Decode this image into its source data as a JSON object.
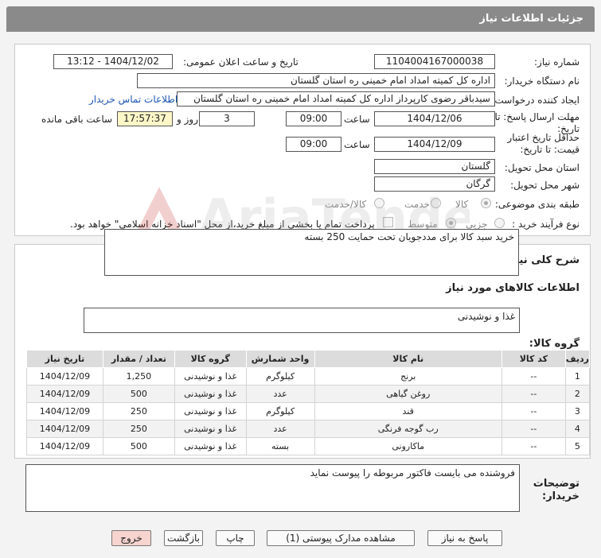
{
  "header": {
    "title": "جزئیات اطلاعات نیاز"
  },
  "form": {
    "need_number_label": "شماره نیاز:",
    "need_number": "1104004167000038",
    "announce_label": "تاریخ و ساعت اعلان عمومی:",
    "announce_value": "1404/12/02 - 13:12",
    "buyer_label": "نام دستگاه خریدار:",
    "buyer_value": "اداره کل کمیته امداد امام خمینی  ره  استان گلستان",
    "creator_label": "ایجاد کننده درخواست:",
    "creator_value": "سیدباقر رضوی کارپرداز اداره کل کمیته امداد امام خمینی  ره  استان گلستان",
    "contact_link": "اطلاعات تماس خریدار",
    "deadline_label_1": "مهلت ارسال پاسخ: تا",
    "deadline_label_2": "تاریخ:",
    "deadline_date": "1404/12/06",
    "time_label": "ساعت",
    "deadline_time": "09:00",
    "days_value": "3",
    "days_label": "روز و",
    "remaining_value": "17:57:37",
    "remaining_label": "ساعت باقی مانده",
    "validity_label_1": "حداقل تاریخ اعتبار",
    "validity_label_2": "قیمت: تا تاریخ:",
    "validity_date": "1404/12/09",
    "validity_time": "09:00",
    "province_label": "استان محل تحویل:",
    "province_value": "گلستان",
    "city_label": "شهر محل تحویل:",
    "city_value": "گرگان",
    "category_label": "طبقه بندی موضوعی:",
    "category_options": [
      "کالا",
      "خدمت",
      "کالا/خدمت"
    ],
    "process_label": "نوع فرآیند خرید :",
    "process_options": [
      "جزیی",
      "متوسط"
    ],
    "process_note": "پرداخت تمام یا بخشی از مبلغ خرید،از محل \"اسناد خزانه اسلامی\" خواهد بود."
  },
  "summary": {
    "label": "شرح کلی نیاز:",
    "value": "خرید سبد کالا برای  مددجویان تحت حمایت  250 بسته"
  },
  "goods": {
    "section_title": "اطلاعات کالاهای مورد نیاز",
    "group_label": "گروه کالا:",
    "group_value": "غذا و نوشیدنی",
    "columns": [
      "ردیف",
      "کد کالا",
      "نام کالا",
      "واحد شمارش",
      "گروه کالا",
      "تعداد / مقدار",
      "تاریخ نیاز"
    ],
    "rows": [
      [
        "1",
        "--",
        "برنج",
        "کیلوگرم",
        "غذا و نوشیدنی",
        "1,250",
        "1404/12/09"
      ],
      [
        "2",
        "--",
        "روغن گیاهی",
        "عدد",
        "غذا و نوشیدنی",
        "500",
        "1404/12/09"
      ],
      [
        "3",
        "--",
        "قند",
        "کیلوگرم",
        "غذا و نوشیدنی",
        "250",
        "1404/12/09"
      ],
      [
        "4",
        "--",
        "رب گوجه فرنگی",
        "عدد",
        "غذا و نوشیدنی",
        "250",
        "1404/12/09"
      ],
      [
        "5",
        "--",
        "ماکارونی",
        "بسته",
        "غذا و نوشیدنی",
        "500",
        "1404/12/09"
      ]
    ]
  },
  "notes": {
    "label_1": "توضیحات",
    "label_2": "خریدار:",
    "value": "فروشنده می بایست فاکتور مربوطه را پیوست نماید"
  },
  "buttons": {
    "reply": "پاسخ به نیاز",
    "attachments": "مشاهده مدارک پیوستی (1)",
    "print": "چاپ",
    "back": "بازگشت",
    "exit": "خروج"
  },
  "watermark": {
    "text": "AriaTender.neT"
  },
  "colors": {
    "header_bg": "#8a8a8a",
    "link": "#1a55b4",
    "highlight": "#fff7c8",
    "exit_bg": "#f7d4cf"
  }
}
